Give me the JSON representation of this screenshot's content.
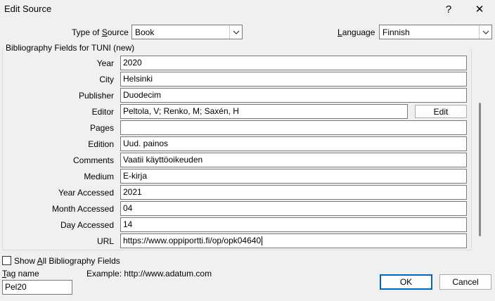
{
  "window": {
    "title": "Edit Source",
    "help_glyph": "?",
    "close_glyph": "✕"
  },
  "top": {
    "type_label_pre": "Type of ",
    "type_label_ul": "S",
    "type_label_post": "ource",
    "type_value": "Book",
    "language_label_ul": "L",
    "language_label_post": "anguage",
    "language_value": "Finnish"
  },
  "group_title": "Bibliography Fields for TUNI (new)",
  "fields": [
    {
      "label": "Year",
      "value": "2020"
    },
    {
      "label": "City",
      "value": "Helsinki"
    },
    {
      "label": "Publisher",
      "value": "Duodecim"
    },
    {
      "label": "Editor",
      "value": "Peltola, V; Renko, M; Saxén, H"
    },
    {
      "label": "Pages",
      "value": ""
    },
    {
      "label": "Edition",
      "value": "Uud. painos"
    },
    {
      "label": "Comments",
      "value": "Vaatii käyttöoikeuden"
    },
    {
      "label": "Medium",
      "value": "E-kirja"
    },
    {
      "label": "Year Accessed",
      "value": "2021"
    },
    {
      "label": "Month Accessed",
      "value": "04"
    },
    {
      "label": "Day Accessed",
      "value": "14"
    },
    {
      "label": "URL",
      "value": "https://www.oppiportti.fi/op/opk04640"
    }
  ],
  "editor_edit_button": "Edit",
  "show_all": {
    "pre": "Show ",
    "ul": "A",
    "post": "ll Bibliography Fields",
    "checked": false
  },
  "tag": {
    "label_ul": "T",
    "label_post": "ag name",
    "value": "Pel20"
  },
  "example_text": "Example: http://www.adatum.com",
  "ok_label": "OK",
  "cancel_label": "Cancel",
  "icons": {
    "dropdown": "chevron-down-icon",
    "help": "help-icon",
    "close": "close-icon"
  }
}
